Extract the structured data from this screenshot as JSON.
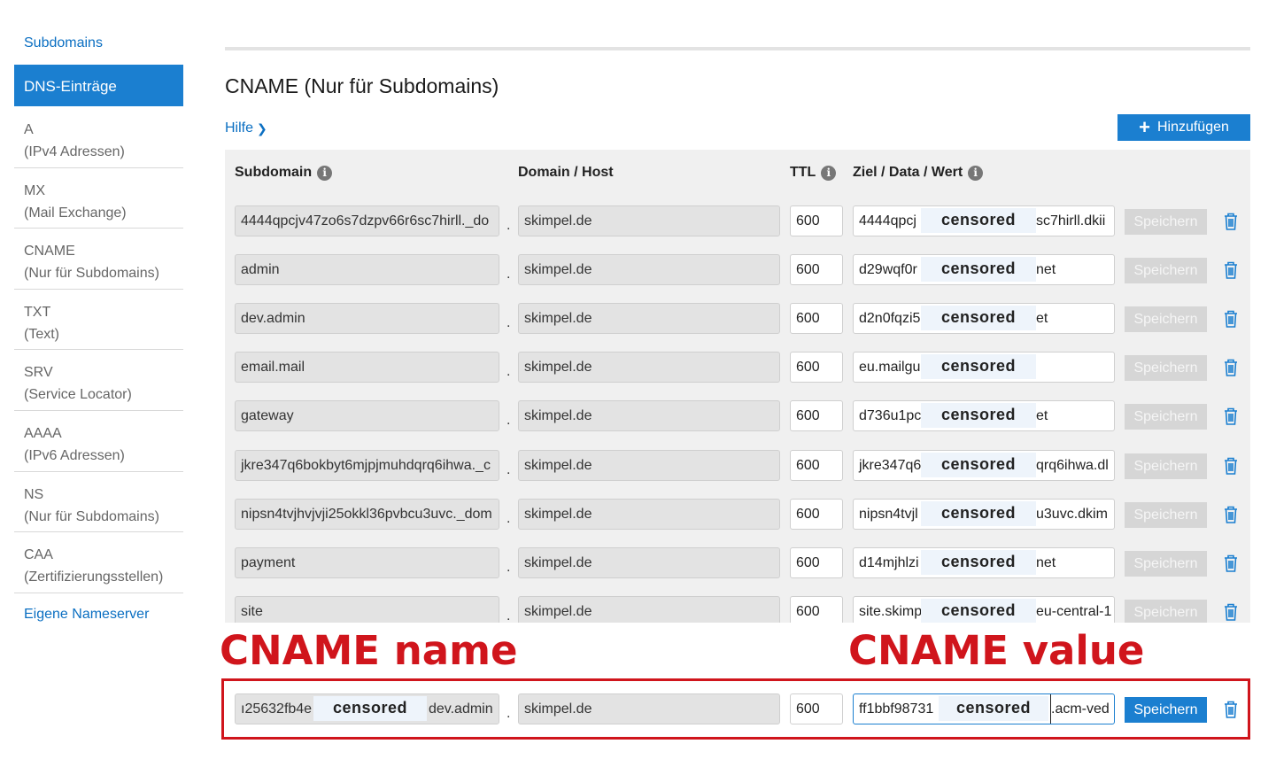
{
  "sidebar": {
    "top_link": "Subdomains",
    "active": "DNS-Einträge",
    "items": [
      {
        "type": "A",
        "desc": "(IPv4 Adressen)"
      },
      {
        "type": "MX",
        "desc": "(Mail Exchange)"
      },
      {
        "type": "CNAME",
        "desc": "(Nur für Subdomains)"
      },
      {
        "type": "TXT",
        "desc": "(Text)"
      },
      {
        "type": "SRV",
        "desc": "(Service Locator)"
      },
      {
        "type": "AAAA",
        "desc": "(IPv6 Adressen)"
      },
      {
        "type": "NS",
        "desc": "(Nur für Subdomains)"
      },
      {
        "type": "CAA",
        "desc": "(Zertifizierungsstellen)"
      }
    ],
    "bottom_link": "Eigene Nameserver"
  },
  "main": {
    "title": "CNAME (Nur für Subdomains)",
    "help": "Hilfe",
    "add_button": "Hinzufügen",
    "columns": {
      "subdomain": "Subdomain",
      "domain": "Domain / Host",
      "ttl": "TTL",
      "value": "Ziel / Data / Wert"
    },
    "censored_label": "censored",
    "save_label": "Speichern",
    "rows": [
      {
        "subdomain": "4444qpcjv47zo6s7dzpv66r6sc7hirll._do",
        "domain": "skimpel.de",
        "ttl": "600",
        "value_left": "4444qpcj",
        "value_right": "sc7hirll.dkii"
      },
      {
        "subdomain": "admin",
        "domain": "skimpel.de",
        "ttl": "600",
        "value_left": "d29wqf0r",
        "value_right": "net"
      },
      {
        "subdomain": "dev.admin",
        "domain": "skimpel.de",
        "ttl": "600",
        "value_left": "d2n0fqzi5",
        "value_right": "et"
      },
      {
        "subdomain": "email.mail",
        "domain": "skimpel.de",
        "ttl": "600",
        "value_left": "eu.mailgu",
        "value_right": ""
      },
      {
        "subdomain": "gateway",
        "domain": "skimpel.de",
        "ttl": "600",
        "value_left": "d736u1pc",
        "value_right": "et"
      },
      {
        "subdomain": "jkre347q6bokbyt6mjpjmuhdqrq6ihwa._c",
        "domain": "skimpel.de",
        "ttl": "600",
        "value_left": "jkre347q6",
        "value_right": "qrq6ihwa.dl"
      },
      {
        "subdomain": "nipsn4tvjhvjvji25okkl36pvbcu3uvc._dom",
        "domain": "skimpel.de",
        "ttl": "600",
        "value_left": "nipsn4tvjl",
        "value_right": "u3uvc.dkim"
      },
      {
        "subdomain": "payment",
        "domain": "skimpel.de",
        "ttl": "600",
        "value_left": "d14mjhlzi",
        "value_right": "net"
      },
      {
        "subdomain": "site",
        "domain": "skimpel.de",
        "ttl": "600",
        "value_left": "site.skimp",
        "value_right": "eu-central-1"
      }
    ],
    "new_row": {
      "subdomain_left": "ı25632fb4e",
      "subdomain_right": "dev.admin",
      "domain": "skimpel.de",
      "ttl": "600",
      "value_left": "ff1bbf98731",
      "value_right": ".acm-ved"
    }
  },
  "annotations": {
    "name_label": "CNAME name",
    "value_label": "CNAME value",
    "color": "#d0151c"
  }
}
